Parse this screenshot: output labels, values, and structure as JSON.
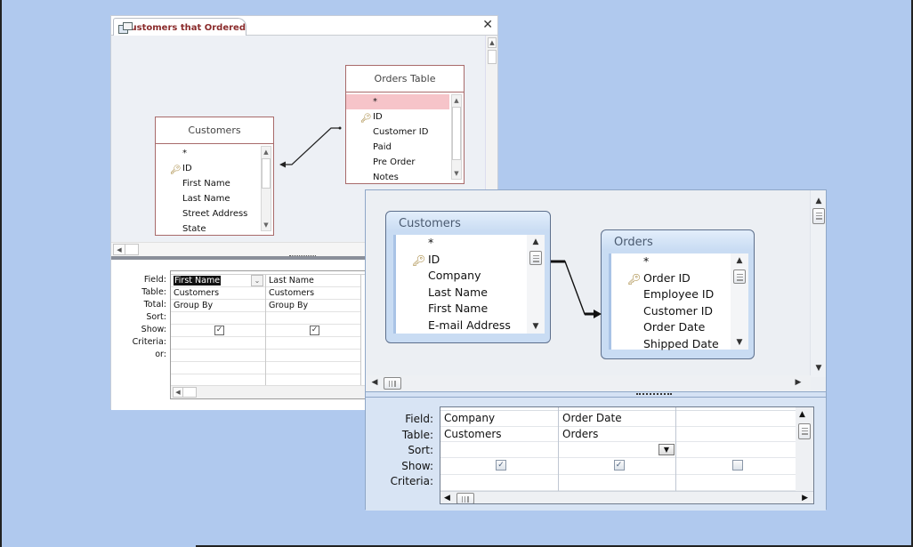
{
  "background_color": "#b0c9ee",
  "window1": {
    "tab_icon": "query-icon",
    "tab_title": "Customers that Ordered",
    "close_glyph": "✕",
    "tables": [
      {
        "title": "Customers",
        "fields": [
          "*",
          "ID",
          "First Name",
          "Last Name",
          "Street Address",
          "State"
        ],
        "key_field": "ID"
      },
      {
        "title": "Orders Table",
        "fields": [
          "*",
          "ID",
          "Customer ID",
          "Paid",
          "Pre Order",
          "Notes"
        ],
        "key_field": "ID",
        "highlighted_field": "*"
      }
    ],
    "grid": {
      "row_labels": [
        "Field:",
        "Table:",
        "Total:",
        "Sort:",
        "Show:",
        "Criteria:",
        "or:"
      ],
      "columns": [
        {
          "field": "First Name",
          "table": "Customers",
          "total": "Group By",
          "sort": "",
          "show": true,
          "criteria": "",
          "or": "",
          "selected": true
        },
        {
          "field": "Last Name",
          "table": "Customers",
          "total": "Group By",
          "sort": "",
          "show": true,
          "criteria": "",
          "or": ""
        }
      ]
    }
  },
  "window2": {
    "tables": [
      {
        "title": "Customers",
        "fields": [
          "*",
          "ID",
          "Company",
          "Last Name",
          "First Name",
          "E-mail Address"
        ],
        "key_field": "ID"
      },
      {
        "title": "Orders",
        "fields": [
          "*",
          "Order ID",
          "Employee ID",
          "Customer ID",
          "Order Date",
          "Shipped Date"
        ],
        "key_field": "Order ID"
      }
    ],
    "grid": {
      "row_labels": [
        "Field:",
        "Table:",
        "Sort:",
        "Show:",
        "Criteria:"
      ],
      "columns": [
        {
          "field": "Company",
          "table": "Customers",
          "sort": "",
          "show": true,
          "criteria": ""
        },
        {
          "field": "Order Date",
          "table": "Orders",
          "sort": "",
          "show": true,
          "criteria": "",
          "sort_dropdown_open": true
        },
        {
          "field": "",
          "table": "",
          "sort": "",
          "show": false,
          "criteria": ""
        }
      ]
    }
  },
  "glyphs": {
    "up": "▲",
    "down": "▼",
    "left": "◀",
    "right": "▶",
    "key": "🔑",
    "check": "✓",
    "chevron": "⌄"
  }
}
